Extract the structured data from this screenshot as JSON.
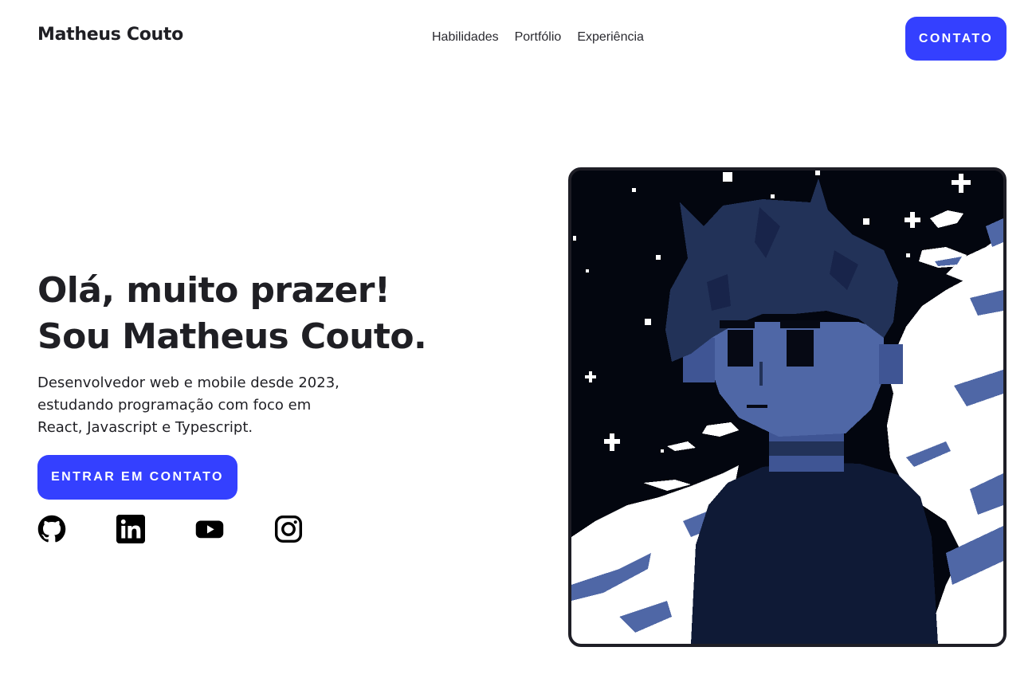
{
  "header": {
    "brand": "Matheus Couto",
    "nav": [
      "Habilidades",
      "Portfólio",
      "Experiência"
    ],
    "contact_button": "CONTATO"
  },
  "hero": {
    "title_line1": "Olá, muito prazer!",
    "title_line2": "Sou Matheus Couto.",
    "description": "Desenvolvedor web e mobile desde 2023, estudando programação com foco em React, Javascript e Typescript.",
    "cta_button": "ENTRAR EM CONTATO",
    "socials": [
      "github-icon",
      "linkedin-icon",
      "youtube-icon",
      "instagram-icon"
    ]
  },
  "colors": {
    "accent": "#3440ff",
    "text": "#1f1f24",
    "avatar_bg": "#03060f",
    "avatar_mid": "#223258",
    "avatar_light": "#4f67a6"
  }
}
